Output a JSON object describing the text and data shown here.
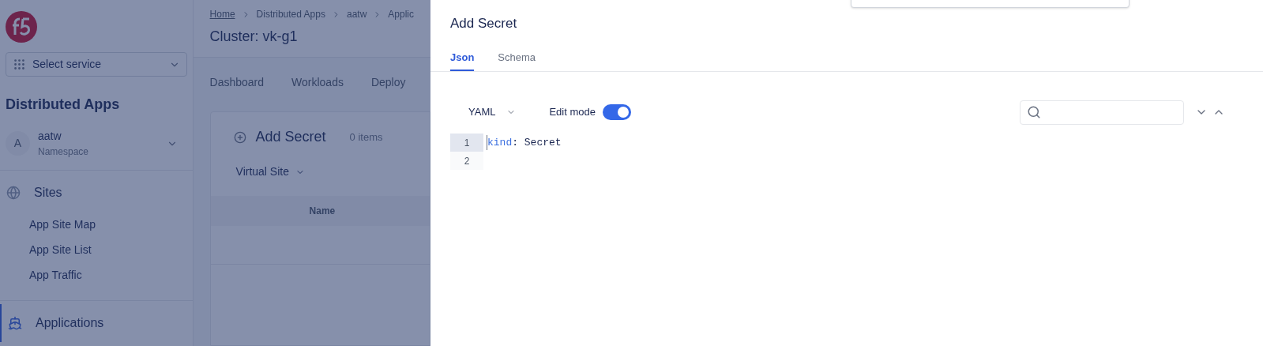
{
  "sidebar": {
    "service_select": {
      "placeholder": "Select service"
    },
    "title": "Distributed Apps",
    "namespace": {
      "avatar": "A",
      "name": "aatw",
      "label": "Namespace"
    },
    "sections": [
      {
        "label": "Sites",
        "selected": false,
        "children": [
          {
            "label": "App Site Map"
          },
          {
            "label": "App Site List"
          },
          {
            "label": "App Traffic"
          }
        ]
      },
      {
        "label": "Applications",
        "selected": true
      }
    ]
  },
  "page": {
    "breadcrumbs": [
      "Home",
      "Distributed Apps",
      "aatw",
      "Applic"
    ],
    "title": "Cluster: vk-g1",
    "tabs": [
      {
        "label": "Dashboard",
        "selected": false
      },
      {
        "label": "Workloads",
        "selected": false
      },
      {
        "label": "Deploy",
        "selected": false
      }
    ],
    "card": {
      "add_label": "Add Secret",
      "count": "0 items",
      "filter": "Virtual Site",
      "columns": [
        "Name"
      ]
    }
  },
  "drawer": {
    "title": "Add Secret",
    "tabs": [
      {
        "label": "Json",
        "selected": true
      },
      {
        "label": "Schema",
        "selected": false
      }
    ],
    "format": "YAML",
    "edit_mode": {
      "label": "Edit mode",
      "on": true
    },
    "lines": [
      {
        "number": "1",
        "selected": true,
        "tokens": [
          {
            "text": "kind",
            "kind": "key"
          },
          {
            "text": ": Secret",
            "kind": "plain"
          }
        ]
      },
      {
        "number": "2",
        "selected": false
      }
    ]
  }
}
